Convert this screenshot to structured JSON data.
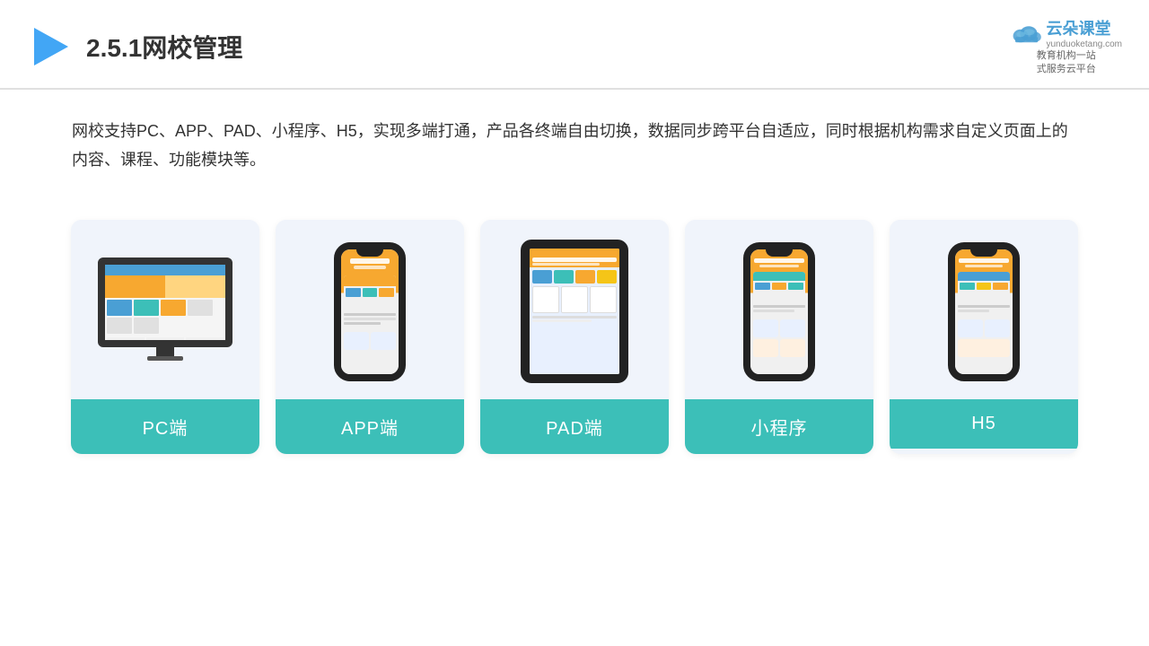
{
  "header": {
    "title": "2.5.1网校管理",
    "logo": {
      "name": "云朵课堂",
      "domain": "yunduoketang.com",
      "tagline": "教育机构一站\n式服务云平台"
    }
  },
  "description": "网校支持PC、APP、PAD、小程序、H5，实现多端打通，产品各终端自由切换，数据同步跨平台自适应，同时根据机构需求自定义页面上的内容、课程、功能模块等。",
  "cards": [
    {
      "id": "pc",
      "label": "PC端",
      "device": "monitor"
    },
    {
      "id": "app",
      "label": "APP端",
      "device": "phone"
    },
    {
      "id": "pad",
      "label": "PAD端",
      "device": "tablet"
    },
    {
      "id": "miniapp",
      "label": "小程序",
      "device": "phone"
    },
    {
      "id": "h5",
      "label": "H5",
      "device": "phone"
    }
  ],
  "colors": {
    "card_bg": "#f0f4fb",
    "card_label_bg": "#3cbfb8",
    "title_color": "#333",
    "accent_blue": "#4a9fd4"
  }
}
